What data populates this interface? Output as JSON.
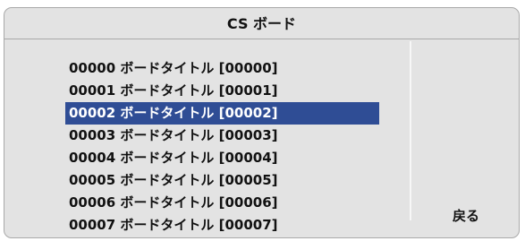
{
  "dialog": {
    "title": "CS ボード",
    "back_label": "戻る"
  },
  "board_list": {
    "selected_index": 2,
    "items": [
      {
        "label": "00000 ボードタイトル [00000]"
      },
      {
        "label": "00001 ボードタイトル [00001]"
      },
      {
        "label": "00002 ボードタイトル [00002]"
      },
      {
        "label": "00003 ボードタイトル [00003]"
      },
      {
        "label": "00004 ボードタイトル [00004]"
      },
      {
        "label": "00005 ボードタイトル [00005]"
      },
      {
        "label": "00006 ボードタイトル [00006]"
      },
      {
        "label": "00007 ボードタイトル [00007]"
      }
    ]
  },
  "colors": {
    "selection": "#2f4d95",
    "panel": "#e3e3e3"
  }
}
